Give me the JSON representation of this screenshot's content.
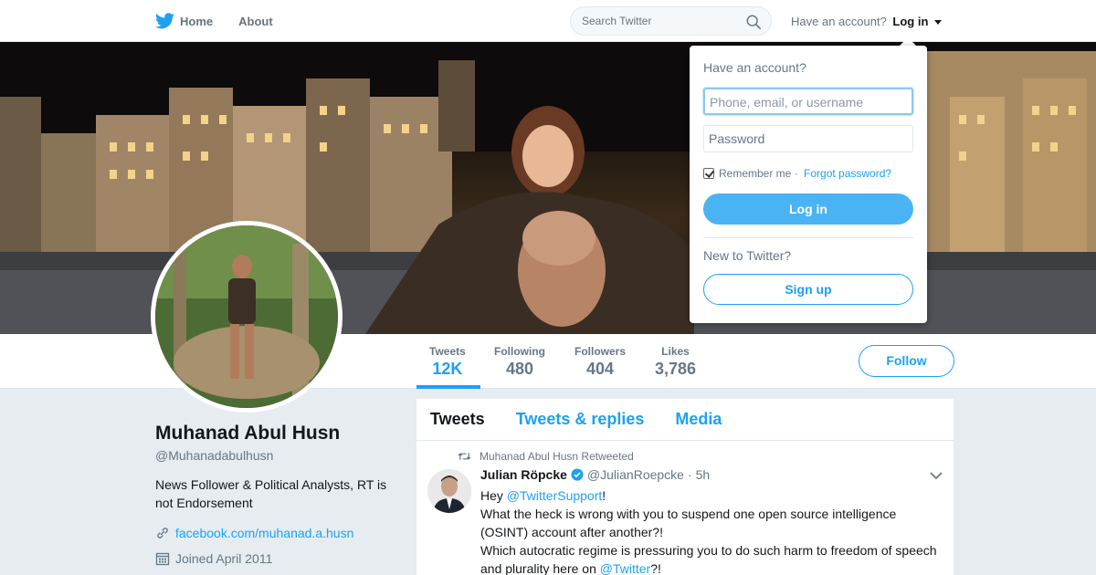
{
  "nav": {
    "home_label": "Home",
    "about_label": "About",
    "search_placeholder": "Search Twitter",
    "have_account_text": "Have an account?",
    "login_label": "Log in"
  },
  "profile": {
    "name": "Muhanad Abul Husn",
    "handle": "@Muhanadabulhusn",
    "bio": "News Follower & Political Analysts, RT is not Endorsement",
    "link": "facebook.com/muhanad.a.husn",
    "joined": "Joined April 2011",
    "follow_label": "Follow"
  },
  "stats": [
    {
      "label": "Tweets",
      "value": "12K"
    },
    {
      "label": "Following",
      "value": "480"
    },
    {
      "label": "Followers",
      "value": "404"
    },
    {
      "label": "Likes",
      "value": "3,786"
    }
  ],
  "timeline": {
    "tabs": [
      "Tweets",
      "Tweets & replies",
      "Media"
    ],
    "tweet": {
      "retweeted_by": "Muhanad Abul Husn Retweeted",
      "author_name": "Julian Röpcke",
      "author_handle": "@JulianRoepcke",
      "time": "5h",
      "body": {
        "l1_pre": "Hey ",
        "l1_mention": "@TwitterSupport",
        "l1_post": "!",
        "l2": "What the heck is wrong with you to suspend one open source intelligence (OSINT) account after another?!",
        "l3_pre": "Which autocratic regime is pressuring you to do such harm to freedom of speech and plurality here on ",
        "l3_mention": "@Twitter",
        "l3_post": "?!"
      }
    }
  },
  "login_dropdown": {
    "title": "Have an account?",
    "username_placeholder": "Phone, email, or username",
    "password_placeholder": "Password",
    "remember_label": "Remember me",
    "separator": " · ",
    "forgot_label": "Forgot password?",
    "login_button": "Log in",
    "new_text": "New to Twitter?",
    "signup_button": "Sign up"
  },
  "colors": {
    "accent": "#1da1f2",
    "login_button_bg": "#4ab3f4",
    "page_bg": "#e6ecf0"
  }
}
